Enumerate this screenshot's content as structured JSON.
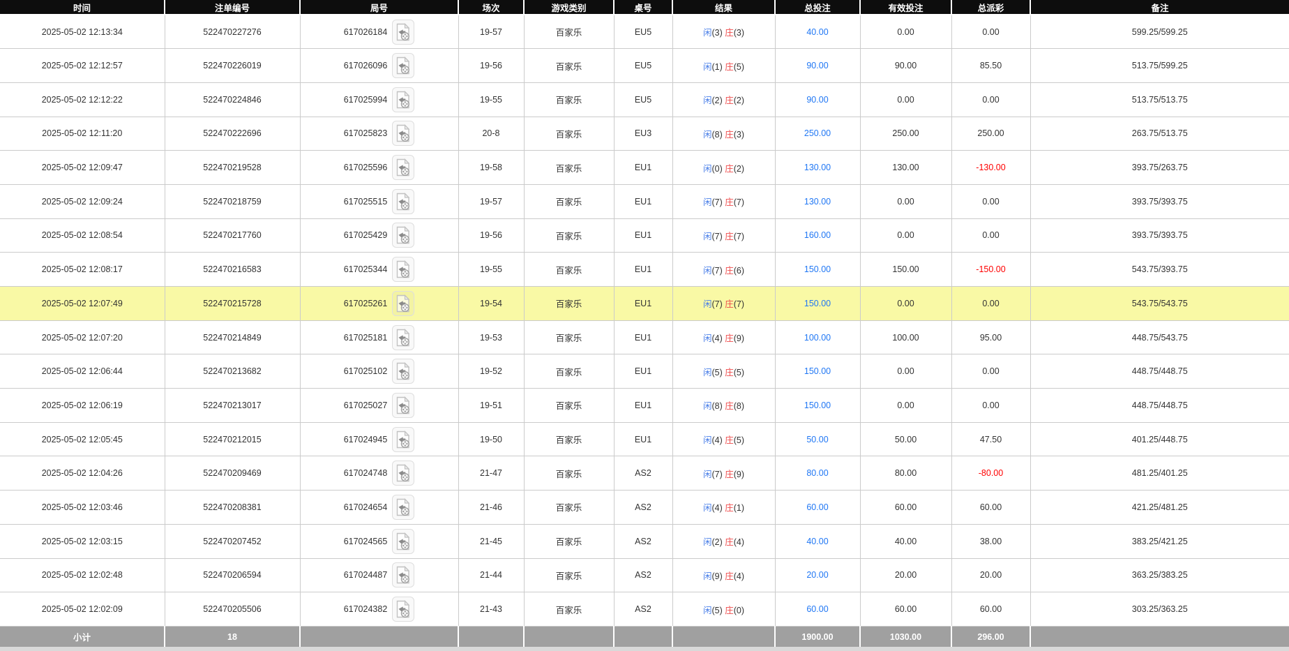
{
  "table": {
    "columns": [
      {
        "key": "time",
        "label": "时间"
      },
      {
        "key": "bet_id",
        "label": "注单编号"
      },
      {
        "key": "round_id",
        "label": "局号"
      },
      {
        "key": "session",
        "label": "场次"
      },
      {
        "key": "game_type",
        "label": "游戏类别"
      },
      {
        "key": "table_no",
        "label": "桌号"
      },
      {
        "key": "result",
        "label": "结果"
      },
      {
        "key": "total_bet",
        "label": "总投注"
      },
      {
        "key": "valid_bet",
        "label": "有效投注"
      },
      {
        "key": "total_payout",
        "label": "总派彩"
      },
      {
        "key": "remark",
        "label": "备注"
      }
    ],
    "rows": [
      {
        "time": "2025-05-02 12:13:34",
        "bet_id": "522470227276",
        "round_id": "617026184",
        "session": "19-57",
        "game_type": "百家乐",
        "table_no": "EU5",
        "player_label": "闲",
        "player_value": "(3)",
        "banker_label": "庄",
        "banker_value": "(3)",
        "total_bet": "40.00",
        "valid_bet": "0.00",
        "total_payout": "0.00",
        "remark": "599.25/599.25",
        "highlighted": false
      },
      {
        "time": "2025-05-02 12:12:57",
        "bet_id": "522470226019",
        "round_id": "617026096",
        "session": "19-56",
        "game_type": "百家乐",
        "table_no": "EU5",
        "player_label": "闲",
        "player_value": "(1)",
        "banker_label": "庄",
        "banker_value": "(5)",
        "total_bet": "90.00",
        "valid_bet": "90.00",
        "total_payout": "85.50",
        "remark": "513.75/599.25",
        "highlighted": false
      },
      {
        "time": "2025-05-02 12:12:22",
        "bet_id": "522470224846",
        "round_id": "617025994",
        "session": "19-55",
        "game_type": "百家乐",
        "table_no": "EU5",
        "player_label": "闲",
        "player_value": "(2)",
        "banker_label": "庄",
        "banker_value": "(2)",
        "total_bet": "90.00",
        "valid_bet": "0.00",
        "total_payout": "0.00",
        "remark": "513.75/513.75",
        "highlighted": false
      },
      {
        "time": "2025-05-02 12:11:20",
        "bet_id": "522470222696",
        "round_id": "617025823",
        "session": "20-8",
        "game_type": "百家乐",
        "table_no": "EU3",
        "player_label": "闲",
        "player_value": "(8)",
        "banker_label": "庄",
        "banker_value": "(3)",
        "total_bet": "250.00",
        "valid_bet": "250.00",
        "total_payout": "250.00",
        "remark": "263.75/513.75",
        "highlighted": false
      },
      {
        "time": "2025-05-02 12:09:47",
        "bet_id": "522470219528",
        "round_id": "617025596",
        "session": "19-58",
        "game_type": "百家乐",
        "table_no": "EU1",
        "player_label": "闲",
        "player_value": "(0)",
        "banker_label": "庄",
        "banker_value": "(2)",
        "total_bet": "130.00",
        "valid_bet": "130.00",
        "total_payout": "-130.00",
        "remark": "393.75/263.75",
        "highlighted": false
      },
      {
        "time": "2025-05-02 12:09:24",
        "bet_id": "522470218759",
        "round_id": "617025515",
        "session": "19-57",
        "game_type": "百家乐",
        "table_no": "EU1",
        "player_label": "闲",
        "player_value": "(7)",
        "banker_label": "庄",
        "banker_value": "(7)",
        "total_bet": "130.00",
        "valid_bet": "0.00",
        "total_payout": "0.00",
        "remark": "393.75/393.75",
        "highlighted": false
      },
      {
        "time": "2025-05-02 12:08:54",
        "bet_id": "522470217760",
        "round_id": "617025429",
        "session": "19-56",
        "game_type": "百家乐",
        "table_no": "EU1",
        "player_label": "闲",
        "player_value": "(7)",
        "banker_label": "庄",
        "banker_value": "(7)",
        "total_bet": "160.00",
        "valid_bet": "0.00",
        "total_payout": "0.00",
        "remark": "393.75/393.75",
        "highlighted": false
      },
      {
        "time": "2025-05-02 12:08:17",
        "bet_id": "522470216583",
        "round_id": "617025344",
        "session": "19-55",
        "game_type": "百家乐",
        "table_no": "EU1",
        "player_label": "闲",
        "player_value": "(7)",
        "banker_label": "庄",
        "banker_value": "(6)",
        "total_bet": "150.00",
        "valid_bet": "150.00",
        "total_payout": "-150.00",
        "remark": "543.75/393.75",
        "highlighted": false
      },
      {
        "time": "2025-05-02 12:07:49",
        "bet_id": "522470215728",
        "round_id": "617025261",
        "session": "19-54",
        "game_type": "百家乐",
        "table_no": "EU1",
        "player_label": "闲",
        "player_value": "(7)",
        "banker_label": "庄",
        "banker_value": "(7)",
        "total_bet": "150.00",
        "valid_bet": "0.00",
        "total_payout": "0.00",
        "remark": "543.75/543.75",
        "highlighted": true
      },
      {
        "time": "2025-05-02 12:07:20",
        "bet_id": "522470214849",
        "round_id": "617025181",
        "session": "19-53",
        "game_type": "百家乐",
        "table_no": "EU1",
        "player_label": "闲",
        "player_value": "(4)",
        "banker_label": "庄",
        "banker_value": "(9)",
        "total_bet": "100.00",
        "valid_bet": "100.00",
        "total_payout": "95.00",
        "remark": "448.75/543.75",
        "highlighted": false
      },
      {
        "time": "2025-05-02 12:06:44",
        "bet_id": "522470213682",
        "round_id": "617025102",
        "session": "19-52",
        "game_type": "百家乐",
        "table_no": "EU1",
        "player_label": "闲",
        "player_value": "(5)",
        "banker_label": "庄",
        "banker_value": "(5)",
        "total_bet": "150.00",
        "valid_bet": "0.00",
        "total_payout": "0.00",
        "remark": "448.75/448.75",
        "highlighted": false
      },
      {
        "time": "2025-05-02 12:06:19",
        "bet_id": "522470213017",
        "round_id": "617025027",
        "session": "19-51",
        "game_type": "百家乐",
        "table_no": "EU1",
        "player_label": "闲",
        "player_value": "(8)",
        "banker_label": "庄",
        "banker_value": "(8)",
        "total_bet": "150.00",
        "valid_bet": "0.00",
        "total_payout": "0.00",
        "remark": "448.75/448.75",
        "highlighted": false
      },
      {
        "time": "2025-05-02 12:05:45",
        "bet_id": "522470212015",
        "round_id": "617024945",
        "session": "19-50",
        "game_type": "百家乐",
        "table_no": "EU1",
        "player_label": "闲",
        "player_value": "(4)",
        "banker_label": "庄",
        "banker_value": "(5)",
        "total_bet": "50.00",
        "valid_bet": "50.00",
        "total_payout": "47.50",
        "remark": "401.25/448.75",
        "highlighted": false
      },
      {
        "time": "2025-05-02 12:04:26",
        "bet_id": "522470209469",
        "round_id": "617024748",
        "session": "21-47",
        "game_type": "百家乐",
        "table_no": "AS2",
        "player_label": "闲",
        "player_value": "(7)",
        "banker_label": "庄",
        "banker_value": "(9)",
        "total_bet": "80.00",
        "valid_bet": "80.00",
        "total_payout": "-80.00",
        "remark": "481.25/401.25",
        "highlighted": false
      },
      {
        "time": "2025-05-02 12:03:46",
        "bet_id": "522470208381",
        "round_id": "617024654",
        "session": "21-46",
        "game_type": "百家乐",
        "table_no": "AS2",
        "player_label": "闲",
        "player_value": "(4)",
        "banker_label": "庄",
        "banker_value": "(1)",
        "total_bet": "60.00",
        "valid_bet": "60.00",
        "total_payout": "60.00",
        "remark": "421.25/481.25",
        "highlighted": false
      },
      {
        "time": "2025-05-02 12:03:15",
        "bet_id": "522470207452",
        "round_id": "617024565",
        "session": "21-45",
        "game_type": "百家乐",
        "table_no": "AS2",
        "player_label": "闲",
        "player_value": "(2)",
        "banker_label": "庄",
        "banker_value": "(4)",
        "total_bet": "40.00",
        "valid_bet": "40.00",
        "total_payout": "38.00",
        "remark": "383.25/421.25",
        "highlighted": false
      },
      {
        "time": "2025-05-02 12:02:48",
        "bet_id": "522470206594",
        "round_id": "617024487",
        "session": "21-44",
        "game_type": "百家乐",
        "table_no": "AS2",
        "player_label": "闲",
        "player_value": "(9)",
        "banker_label": "庄",
        "banker_value": "(4)",
        "total_bet": "20.00",
        "valid_bet": "20.00",
        "total_payout": "20.00",
        "remark": "363.25/383.25",
        "highlighted": false
      },
      {
        "time": "2025-05-02 12:02:09",
        "bet_id": "522470205506",
        "round_id": "617024382",
        "session": "21-43",
        "game_type": "百家乐",
        "table_no": "AS2",
        "player_label": "闲",
        "player_value": "(5)",
        "banker_label": "庄",
        "banker_value": "(0)",
        "total_bet": "60.00",
        "valid_bet": "60.00",
        "total_payout": "60.00",
        "remark": "303.25/363.25",
        "highlighted": false
      }
    ],
    "footer": {
      "label": "小计",
      "count": "18",
      "total_bet": "1900.00",
      "valid_bet": "1030.00",
      "total_payout": "296.00"
    },
    "icons": {
      "video_icon": "video-playback-icon"
    }
  },
  "colors": {
    "header_bg": "#0d0d0d",
    "header_text": "#ffffff",
    "row_highlight": "#f9f9a5",
    "grid_line": "#cbcbcb",
    "player_blue": "#4a7fe8",
    "banker_red": "#ee4c4c",
    "bet_link_blue": "#2077f4",
    "negative_red": "#ff0000",
    "footer_bg": "#a0a0a0"
  }
}
